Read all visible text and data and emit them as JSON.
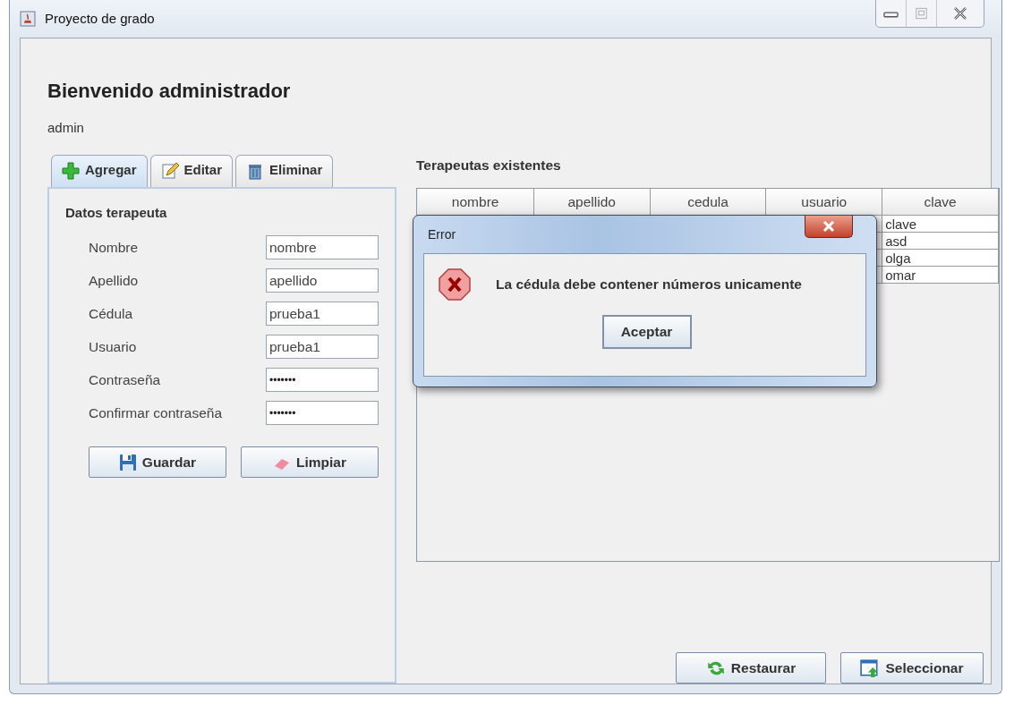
{
  "window": {
    "title": "Proyecto de grado"
  },
  "header": {
    "title": "Bienvenido administrador",
    "user": "admin"
  },
  "tabs": [
    {
      "label": "Agregar",
      "selected": true
    },
    {
      "label": "Editar",
      "selected": false
    },
    {
      "label": "Eliminar",
      "selected": false
    }
  ],
  "form": {
    "title": "Datos terapeuta",
    "fields": [
      {
        "label": "Nombre",
        "value": "nombre",
        "kind": "text"
      },
      {
        "label": "Apellido",
        "value": "apellido",
        "kind": "text"
      },
      {
        "label": "Cédula",
        "value": "prueba1",
        "kind": "text"
      },
      {
        "label": "Usuario",
        "value": "prueba1",
        "kind": "text"
      },
      {
        "label": "Contraseña",
        "value": "•••••••",
        "kind": "password"
      },
      {
        "label": "Confirmar contraseña",
        "value": "•••••••",
        "kind": "password"
      }
    ],
    "buttons": [
      "Guardar",
      "Limpiar"
    ]
  },
  "table": {
    "title": "Terapeutas existentes",
    "columns": [
      "nombre",
      "apellido",
      "cedula",
      "usuario",
      "clave"
    ],
    "rows": [
      {
        "clave": "clave"
      },
      {
        "clave": "asd"
      },
      {
        "clave": "olga"
      },
      {
        "clave": "omar"
      }
    ]
  },
  "bottom_buttons": [
    "Restaurar",
    "Seleccionar"
  ],
  "dialog": {
    "title": "Error",
    "message": "La cédula debe contener números unicamente",
    "button": "Aceptar"
  }
}
